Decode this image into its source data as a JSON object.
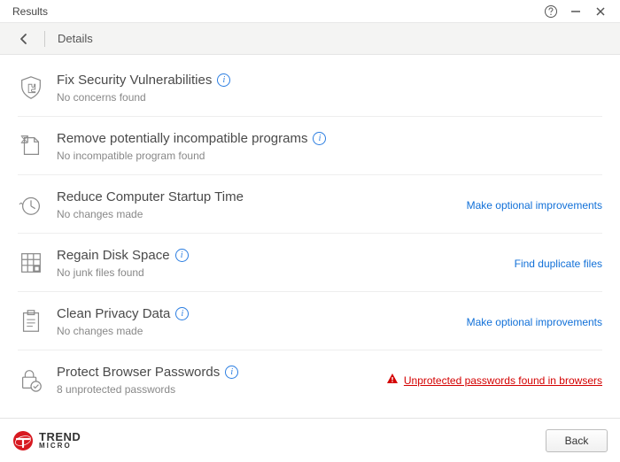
{
  "window": {
    "title": "Results"
  },
  "subheader": {
    "crumb": "Details"
  },
  "rows": [
    {
      "icon": "shield-puzzle-icon",
      "title": "Fix Security Vulnerabilities",
      "subtitle": "No concerns found",
      "info": true,
      "action": null
    },
    {
      "icon": "broken-doc-icon",
      "title": "Remove potentially incompatible programs",
      "subtitle": "No incompatible program found",
      "info": true,
      "action": null
    },
    {
      "icon": "stopwatch-icon",
      "title": "Reduce Computer Startup Time",
      "subtitle": "No changes made",
      "info": false,
      "action": {
        "type": "link",
        "label": "Make optional improvements"
      }
    },
    {
      "icon": "disk-grid-icon",
      "title": "Regain Disk Space",
      "subtitle": "No junk files found",
      "info": true,
      "action": {
        "type": "link",
        "label": "Find duplicate files"
      }
    },
    {
      "icon": "clipboard-icon",
      "title": "Clean Privacy Data",
      "subtitle": "No changes made",
      "info": true,
      "action": {
        "type": "link",
        "label": "Make optional improvements"
      }
    },
    {
      "icon": "lock-check-icon",
      "title": "Protect Browser Passwords",
      "subtitle": "8 unprotected passwords",
      "info": true,
      "action": {
        "type": "warn",
        "label": "Unprotected passwords found in browsers"
      }
    }
  ],
  "footer": {
    "brand1": "TREND",
    "brand2": "MICRO",
    "back_label": "Back"
  }
}
